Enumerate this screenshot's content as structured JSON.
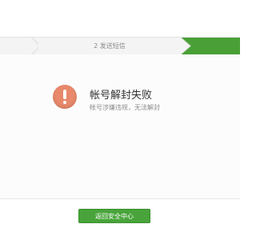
{
  "steps": {
    "items": [
      {
        "label": ""
      },
      {
        "label": "2 发送短信"
      },
      {
        "label": ""
      }
    ],
    "active_color": "#4aa037",
    "inactive_color": "#f4f4f4"
  },
  "result": {
    "icon": "exclamation-circle-icon",
    "icon_color": "#e8896b",
    "title": "帐号解封失败",
    "description": "帐号涉嫌违规，无法解封"
  },
  "footer": {
    "return_label": "返回安全中心",
    "button_color": "#48a43a"
  }
}
